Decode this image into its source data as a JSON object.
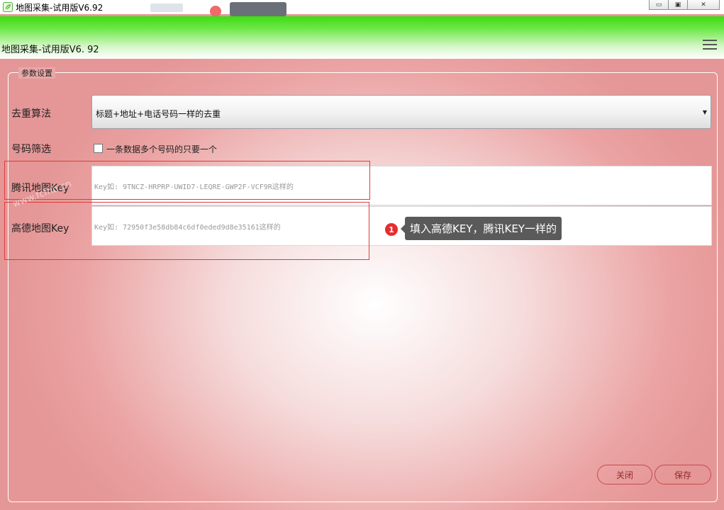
{
  "window": {
    "title": "地图采集-试用版V6.92",
    "controls": {
      "minimize": "▭",
      "maximize": "▣",
      "close": "✕"
    }
  },
  "header": {
    "title": "地图采集-试用版V6. 92",
    "menu_icon": "hamburger-menu-icon"
  },
  "settings": {
    "legend": "参数设置",
    "dedup": {
      "label": "去重算法",
      "value": "标题+地址+电话号码一样的去重"
    },
    "number_filter": {
      "label": "号码筛选",
      "checkbox_label": "一条数据多个号码的只要一个",
      "checked": false
    },
    "tencent_key": {
      "label": "腾讯地图Key",
      "placeholder": "Key如: 9TNCZ-HRPRP-UWID7-LEQRE-GWP2F-VCF9R这样的"
    },
    "amap_key": {
      "label": "高德地图Key",
      "placeholder": "Key如: 72950f3e58db84c6df0eded9d8e35161这样的"
    }
  },
  "callout": {
    "number": "1",
    "text": "填入高德KEY，腾讯KEY一样的"
  },
  "watermark": "www.fcfhb.cn",
  "buttons": {
    "close": "关闭",
    "save": "保存"
  },
  "colors": {
    "accent_green": "#3edb13",
    "background_pink": "#e59696",
    "highlight_red": "#e03a3a",
    "callout_dark": "#5a5a5a"
  }
}
